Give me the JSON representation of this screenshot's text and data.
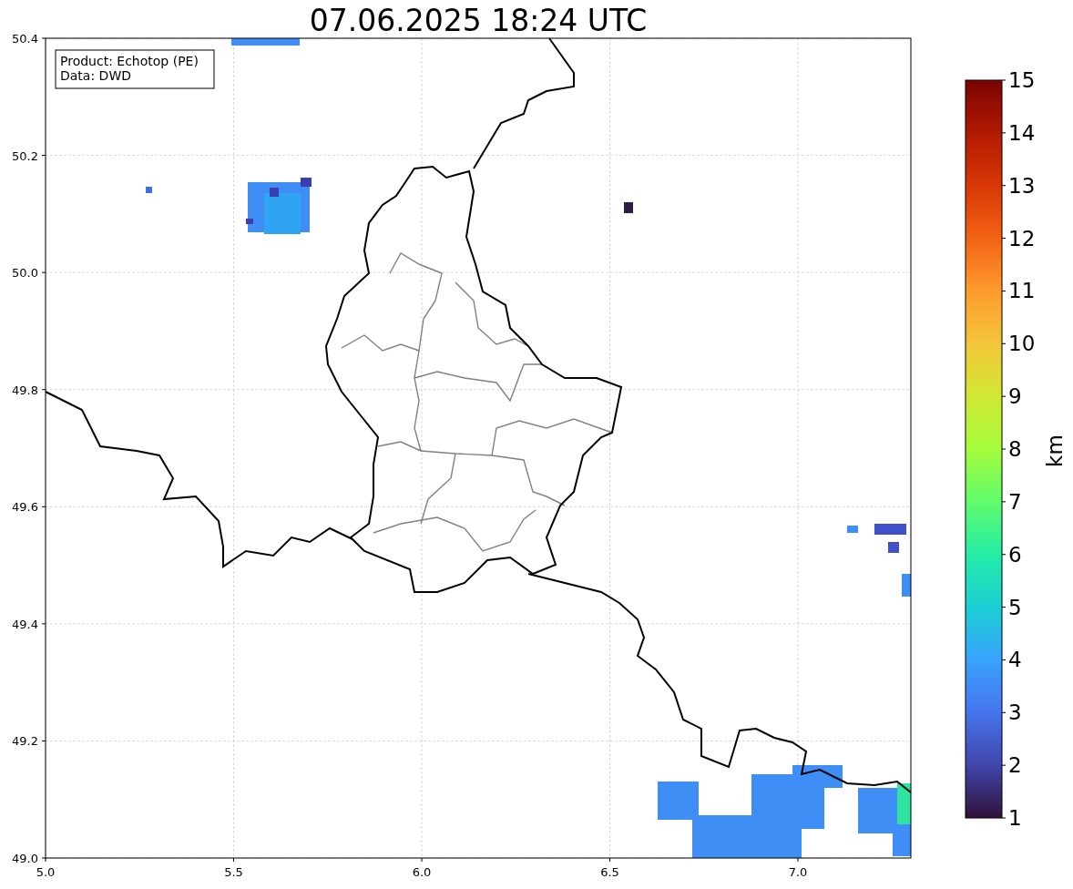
{
  "title": "07.06.2025 18:24 UTC",
  "info_box": [
    "Product: Echotop (PE)",
    "Data: DWD"
  ],
  "map": {
    "xticks": [
      "5.0",
      "5.5",
      "6.0",
      "6.5",
      "7.0"
    ],
    "yticks": [
      "50.4",
      "50.2",
      "50.0",
      "49.8",
      "49.6",
      "49.4",
      "49.2",
      "49.0"
    ]
  },
  "colorbar": {
    "label": "km",
    "ticks": [
      "15",
      "14",
      "13",
      "12",
      "11",
      "10",
      "9",
      "8",
      "7",
      "6",
      "5",
      "4",
      "3",
      "2",
      "1"
    ]
  }
}
